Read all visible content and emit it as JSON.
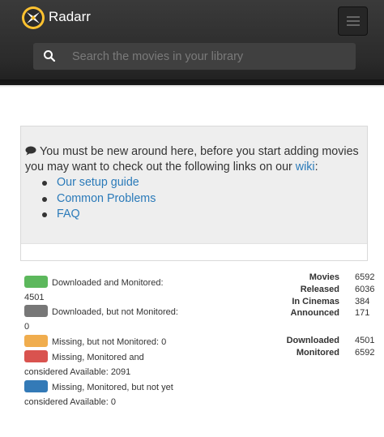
{
  "app": {
    "title": "Radarr"
  },
  "search": {
    "placeholder": "Search the movies in your library"
  },
  "notice": {
    "line1": "You must be new around here, before you start adding movies",
    "line2_prefix": "you may want to check out the following links on our ",
    "wiki_link": "wiki",
    "line2_suffix": ":",
    "links": [
      "Our setup guide",
      "Common Problems",
      "FAQ"
    ]
  },
  "legend": {
    "items": [
      {
        "label": "Downloaded and Monitored:",
        "value": "4501",
        "color": "#5cb85c"
      },
      {
        "label": "Downloaded, but not Monitored:",
        "value": "0",
        "color": "#777777"
      },
      {
        "label": "Missing, but not Monitored: 0",
        "color": "#f0ad4e"
      },
      {
        "label": "Missing, Monitored and",
        "cont": "considered Available: 2091",
        "color": "#d9534f"
      },
      {
        "label": "Missing, Monitored, but not yet",
        "cont": "considered Available: 0",
        "color": "#337ab7"
      }
    ]
  },
  "stats": {
    "movies": {
      "label": "Movies",
      "value": "6592"
    },
    "released": {
      "label": "Released",
      "value": "6036"
    },
    "in_cinemas": {
      "label": "In Cinemas",
      "value": "384"
    },
    "announced": {
      "label": "Announced",
      "value": "171"
    },
    "downloaded": {
      "label": "Downloaded",
      "value": "4501"
    },
    "monitored": {
      "label": "Monitored",
      "value": "6592"
    }
  }
}
